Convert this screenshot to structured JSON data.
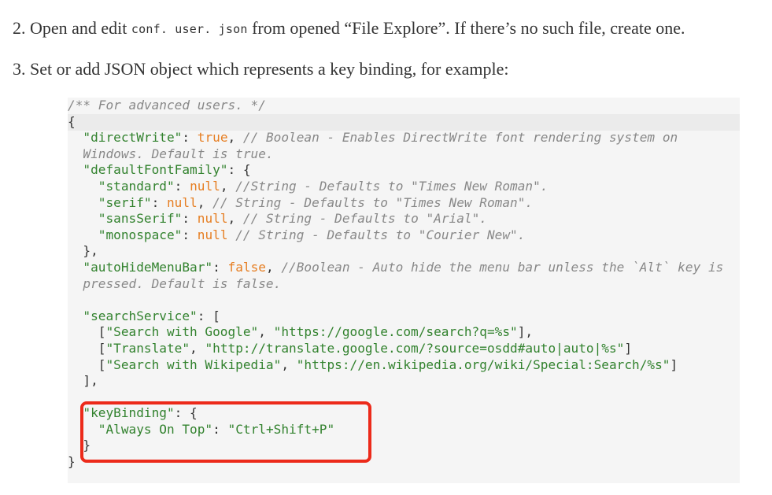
{
  "steps": {
    "step2": {
      "prefix": "2. Open and edit ",
      "file": "conf. user. json",
      "suffix": " from opened “File Explore”. If there’s no such file, create one."
    },
    "step3": {
      "text": "3. Set or add JSON object which represents a key binding, for example:"
    }
  },
  "code_block": {
    "lines": [
      [
        {
          "t": "/** For advanced users. */",
          "c": "cm"
        }
      ],
      [
        {
          "t": "{",
          "c": "pn"
        }
      ],
      [
        {
          "t": "  ",
          "c": "pn"
        },
        {
          "t": "\"directWrite\"",
          "c": "str"
        },
        {
          "t": ": ",
          "c": "pn"
        },
        {
          "t": "true",
          "c": "kw"
        },
        {
          "t": ", ",
          "c": "pn"
        },
        {
          "t": "// Boolean - Enables DirectWrite font rendering system on",
          "c": "cm"
        }
      ],
      [
        {
          "t": "  Windows. Default is true.",
          "c": "cm"
        }
      ],
      [
        {
          "t": "  ",
          "c": "pn"
        },
        {
          "t": "\"defaultFontFamily\"",
          "c": "str"
        },
        {
          "t": ": {",
          "c": "pn"
        }
      ],
      [
        {
          "t": "    ",
          "c": "pn"
        },
        {
          "t": "\"standard\"",
          "c": "str"
        },
        {
          "t": ": ",
          "c": "pn"
        },
        {
          "t": "null",
          "c": "kw"
        },
        {
          "t": ", ",
          "c": "pn"
        },
        {
          "t": "//String - Defaults to \"Times New Roman\".",
          "c": "cm"
        }
      ],
      [
        {
          "t": "    ",
          "c": "pn"
        },
        {
          "t": "\"serif\"",
          "c": "str"
        },
        {
          "t": ": ",
          "c": "pn"
        },
        {
          "t": "null",
          "c": "kw"
        },
        {
          "t": ", ",
          "c": "pn"
        },
        {
          "t": "// String - Defaults to \"Times New Roman\".",
          "c": "cm"
        }
      ],
      [
        {
          "t": "    ",
          "c": "pn"
        },
        {
          "t": "\"sansSerif\"",
          "c": "str"
        },
        {
          "t": ": ",
          "c": "pn"
        },
        {
          "t": "null",
          "c": "kw"
        },
        {
          "t": ", ",
          "c": "pn"
        },
        {
          "t": "// String - Defaults to \"Arial\".",
          "c": "cm"
        }
      ],
      [
        {
          "t": "    ",
          "c": "pn"
        },
        {
          "t": "\"monospace\"",
          "c": "str"
        },
        {
          "t": ": ",
          "c": "pn"
        },
        {
          "t": "null",
          "c": "kw"
        },
        {
          "t": " ",
          "c": "pn"
        },
        {
          "t": "// String - Defaults to \"Courier New\".",
          "c": "cm"
        }
      ],
      [
        {
          "t": "  },",
          "c": "pn"
        }
      ],
      [
        {
          "t": "  ",
          "c": "pn"
        },
        {
          "t": "\"autoHideMenuBar\"",
          "c": "str"
        },
        {
          "t": ": ",
          "c": "pn"
        },
        {
          "t": "false",
          "c": "kw"
        },
        {
          "t": ", ",
          "c": "pn"
        },
        {
          "t": "//Boolean - Auto hide the menu bar unless the `Alt` key is",
          "c": "cm"
        }
      ],
      [
        {
          "t": "  pressed. Default is false.",
          "c": "cm"
        }
      ],
      [
        {
          "t": "",
          "c": "pn"
        }
      ],
      [
        {
          "t": "  ",
          "c": "pn"
        },
        {
          "t": "\"searchService\"",
          "c": "str"
        },
        {
          "t": ": [",
          "c": "pn"
        }
      ],
      [
        {
          "t": "    [",
          "c": "pn"
        },
        {
          "t": "\"Search with Google\"",
          "c": "str"
        },
        {
          "t": ", ",
          "c": "pn"
        },
        {
          "t": "\"https://google.com/search?q=%s\"",
          "c": "str"
        },
        {
          "t": "],",
          "c": "pn"
        }
      ],
      [
        {
          "t": "    [",
          "c": "pn"
        },
        {
          "t": "\"Translate\"",
          "c": "str"
        },
        {
          "t": ", ",
          "c": "pn"
        },
        {
          "t": "\"http://translate.google.com/?source=osdd#auto|auto|%s\"",
          "c": "str"
        },
        {
          "t": "]",
          "c": "pn"
        }
      ],
      [
        {
          "t": "    [",
          "c": "pn"
        },
        {
          "t": "\"Search with Wikipedia\"",
          "c": "str"
        },
        {
          "t": ", ",
          "c": "pn"
        },
        {
          "t": "\"https://en.wikipedia.org/wiki/Special:Search/%s\"",
          "c": "str"
        },
        {
          "t": "]",
          "c": "pn"
        }
      ],
      [
        {
          "t": "  ],",
          "c": "pn"
        }
      ],
      [
        {
          "t": "",
          "c": "pn"
        }
      ],
      [
        {
          "t": "  ",
          "c": "pn"
        },
        {
          "t": "\"keyBinding\"",
          "c": "str"
        },
        {
          "t": ": {",
          "c": "pn"
        }
      ],
      [
        {
          "t": "    ",
          "c": "pn"
        },
        {
          "t": "\"Always On Top\"",
          "c": "str"
        },
        {
          "t": ": ",
          "c": "pn"
        },
        {
          "t": "\"Ctrl+Shift+P\"",
          "c": "str"
        }
      ],
      [
        {
          "t": "  }",
          "c": "pn"
        }
      ],
      [
        {
          "t": "}",
          "c": "pn"
        }
      ]
    ]
  },
  "colors": {
    "highlight_border": "#ec2a1a",
    "string": "#32822e",
    "keyword": "#e67e22",
    "comment": "#888888",
    "code_background": "#f5f5f5"
  }
}
